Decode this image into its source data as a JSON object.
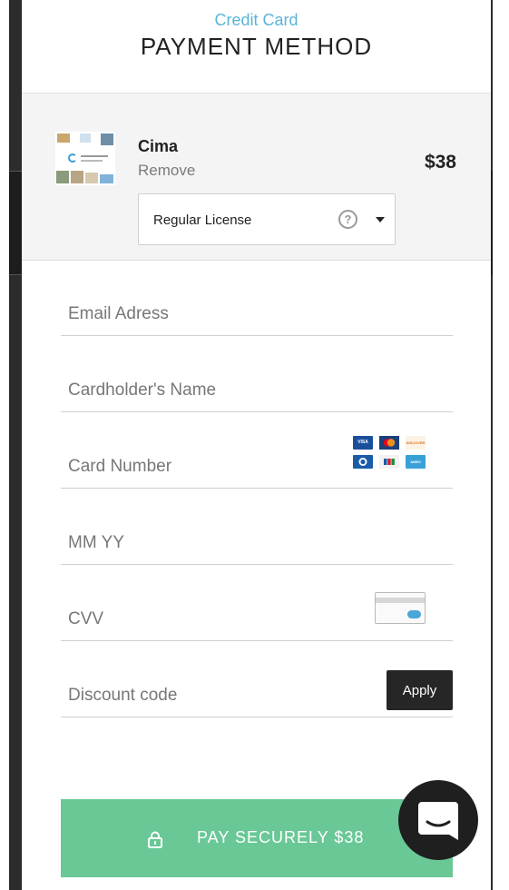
{
  "header": {
    "subtitle": "Credit Card",
    "title": "PAYMENT METHOD"
  },
  "cart": {
    "product_name": "Cima",
    "remove_label": "Remove",
    "price": "$38",
    "license": {
      "selected": "Regular License",
      "help_symbol": "?"
    }
  },
  "form": {
    "email_placeholder": "Email Adress",
    "cardholder_placeholder": "Cardholder's Name",
    "card_number_placeholder": "Card Number",
    "expiry_placeholder": "MM YY",
    "cvv_placeholder": "CVV",
    "discount_placeholder": "Discount code",
    "apply_label": "Apply",
    "card_brands": [
      {
        "name": "VISA",
        "color": "#1a4f9c"
      },
      {
        "name": "mastercard",
        "color": "#eb6f1d"
      },
      {
        "name": "DISCOVER",
        "color": "#f3a45a"
      },
      {
        "name": "diners",
        "color": "#1a5ca8"
      },
      {
        "name": "JCB",
        "color": "#2b6bbf"
      },
      {
        "name": "AMEX",
        "color": "#3aa0d8"
      }
    ]
  },
  "pay": {
    "label": "PAY SECURELY $38",
    "color": "#69c896"
  },
  "colors": {
    "accent": "#5ab4d6"
  }
}
